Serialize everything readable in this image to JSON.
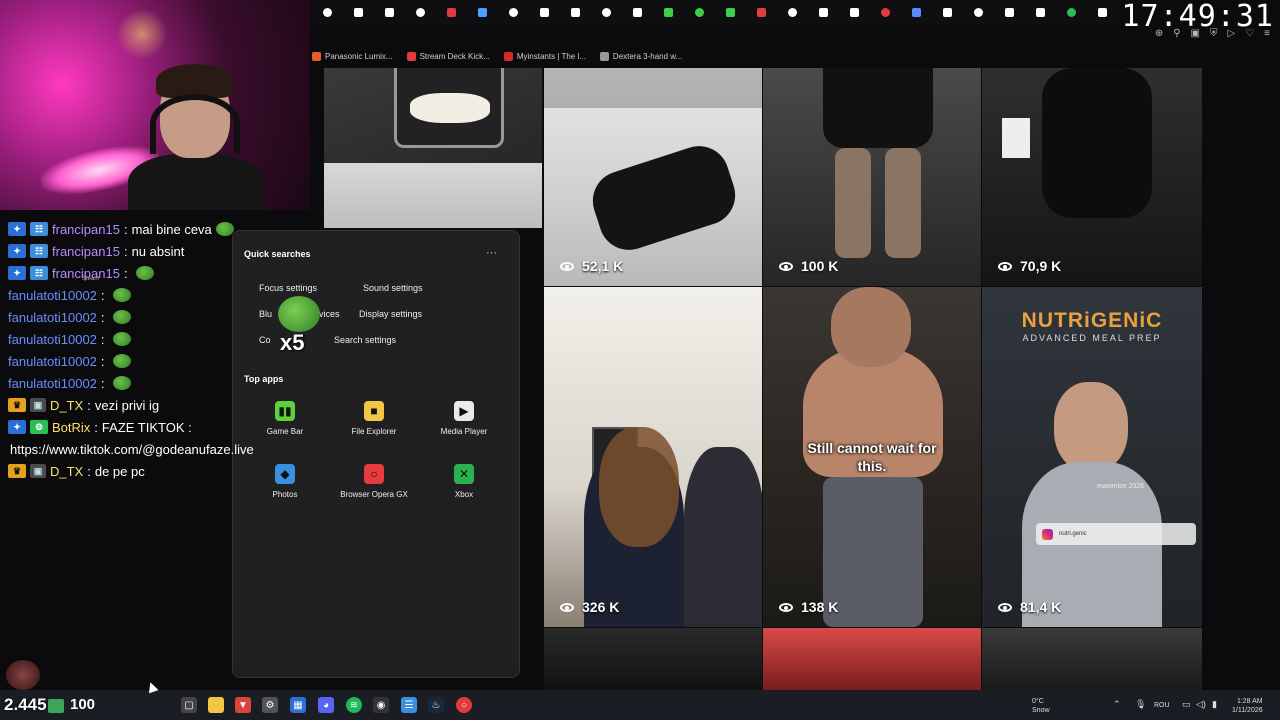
{
  "clock": "17:49:31",
  "browser": {
    "tab_icon_colors": [
      "#ffffff",
      "#ffffff",
      "#ffffff",
      "#ffffff",
      "#e23b3b",
      "#4aa3ff",
      "#ffffff",
      "#ffffff",
      "#ffffff",
      "#ffffff",
      "#ffffff",
      "#3ecf4a",
      "#3ecf4a",
      "#3ecf4a",
      "#e23b3b",
      "#ffffff",
      "#ffffff",
      "#ffffff",
      "#e23b3b",
      "#5b8cff",
      "#ffffff",
      "#ffffff",
      "#ffffff",
      "#ffffff",
      "#2bbd58",
      "#ffffff"
    ],
    "bookmarks": [
      {
        "label": "Panasonic Lumix...",
        "color": "#e85d2b"
      },
      {
        "label": "Stream Deck Kick...",
        "color": "#e23b3b"
      },
      {
        "label": "Myinstants | The l...",
        "color": "#d62828"
      },
      {
        "label": "Dextera 3-hand w...",
        "color": "#999999"
      }
    ]
  },
  "videos": [
    {
      "views": "52,1 K"
    },
    {
      "views": "100 K"
    },
    {
      "views": "70,9 K"
    },
    {
      "views": "326 K"
    },
    {
      "views": "138 K",
      "caption_line1": "Still cannot wait for",
      "caption_line2": "this."
    },
    {
      "views": "81,4 K",
      "brand": "NUTRiGENiC",
      "brand_sub": "ADVANCED MEAL PREP",
      "watermark": "maximise 2026",
      "insta_handle": "nutri.genic"
    }
  ],
  "chat": {
    "lines": [
      {
        "user": "francipan15",
        "user_color": "#b58cff",
        "msg": "mai bine ceva"
      },
      {
        "user": "francipan15",
        "user_color": "#b58cff",
        "msg": "nu absint"
      },
      {
        "user": "francipan15",
        "user_color": "#b58cff",
        "msg": ""
      },
      {
        "user": "fanulatoti10002",
        "user_color": "#6c8cff",
        "msg": ""
      },
      {
        "user": "fanulatoti10002",
        "user_color": "#6c8cff",
        "msg": ""
      },
      {
        "user": "fanulatoti10002",
        "user_color": "#6c8cff",
        "msg": ""
      },
      {
        "user": "fanulatoti10002",
        "user_color": "#6c8cff",
        "msg": ""
      },
      {
        "user": "fanulatoti10002",
        "user_color": "#6c8cff",
        "msg": ""
      },
      {
        "user": "D_TX",
        "user_color": "#ffe066",
        "msg": "vezi privi ig"
      },
      {
        "user": "BotRix",
        "user_color": "#ffe066",
        "msg": "FAZE TIKTOK :"
      },
      {
        "user": "D_TX",
        "user_color": "#ffe066",
        "msg": "de pe pc"
      }
    ],
    "link_line": "https://www.tiktok.com/@godeanufaze.live",
    "steam_label": "Steam"
  },
  "start_panel": {
    "quick_title": "Quick searches",
    "more": "···",
    "quick": [
      "Focus settings",
      "Sound settings",
      "Blu",
      "vices",
      "Display settings",
      "Co",
      "Search settings"
    ],
    "apps_title": "Top apps",
    "apps": [
      {
        "label": "Game Bar",
        "color": "#5fd13b",
        "icon": "▮▮"
      },
      {
        "label": "File Explorer",
        "color": "#f2c744",
        "icon": "■"
      },
      {
        "label": "Media Player",
        "color": "#eaeaea",
        "icon": "▶"
      },
      {
        "label": "Photos",
        "color": "#3a8fe0",
        "icon": "◆"
      },
      {
        "label": "Browser Opera GX",
        "color": "#e83c3c",
        "icon": "○"
      },
      {
        "label": "Xbox",
        "color": "#2bb24c",
        "icon": "✕"
      }
    ],
    "x5": "x5"
  },
  "taskbar": {
    "counter": "2.445",
    "counter_value": "100",
    "weather_line1": "0°C",
    "weather_line2": "Snow",
    "lang": "ROU",
    "time": "1:28 AM",
    "date": "1/11/2026"
  }
}
